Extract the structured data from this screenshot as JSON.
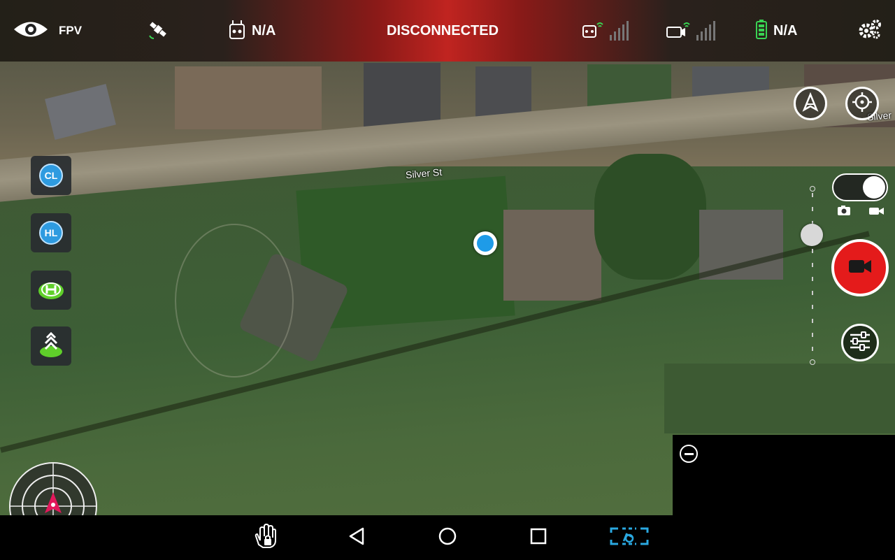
{
  "topbar": {
    "view_mode": "FPV",
    "remote_status": "N/A",
    "connection_status": "DISCONNECTED",
    "battery_status": "N/A"
  },
  "map": {
    "street_name": "Silver St",
    "street_name_edge": "Silver"
  },
  "left_buttons": [
    {
      "label": "CL",
      "icon": "cl-icon"
    },
    {
      "label": "HL",
      "icon": "hl-icon"
    },
    {
      "label": "",
      "icon": "helipad-icon"
    },
    {
      "label": "",
      "icon": "takeoff-icon"
    }
  ],
  "right_controls": {
    "mode_toggle": "video",
    "record_button": "record",
    "settings_icon": "sliders-icon"
  },
  "colors": {
    "accent_red": "#e41b1b",
    "location_blue": "#1e9be8",
    "battery_green": "#39d353",
    "helipad_green": "#5fcf2a",
    "nav_active": "#2aa8e0"
  }
}
